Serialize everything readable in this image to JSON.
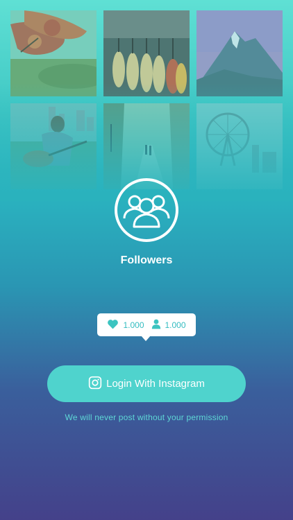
{
  "photo_grid": {
    "tiles": [
      {
        "subject": "autumn-tree-lake"
      },
      {
        "subject": "guitar-rack"
      },
      {
        "subject": "mountain-peak"
      },
      {
        "subject": "man-playing-guitar-park"
      },
      {
        "subject": "misty-park-path-couple"
      },
      {
        "subject": "ferris-wheel-city"
      }
    ]
  },
  "hero": {
    "icon": "followers-group-icon",
    "title": "Followers"
  },
  "stats": {
    "likes_icon": "heart-icon",
    "likes_value": "1.000",
    "followers_icon": "person-icon",
    "followers_value": "1.000"
  },
  "login": {
    "icon": "instagram-icon",
    "label": "Login With Instagram"
  },
  "footer": {
    "note": "We will never post without your permission"
  },
  "colors": {
    "accent": "#4fd3cd",
    "gradient_top": "#5fe0d4",
    "gradient_bottom": "#44418a",
    "text_white": "#ffffff"
  }
}
